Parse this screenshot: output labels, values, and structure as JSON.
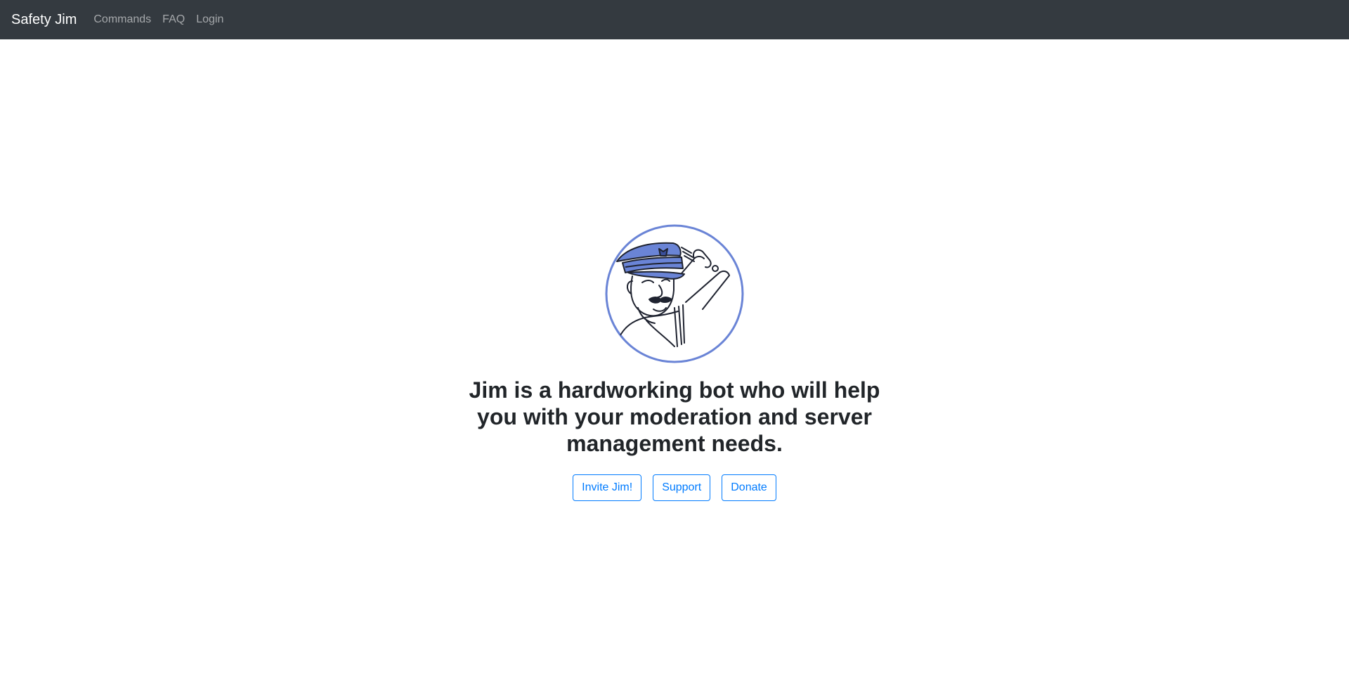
{
  "navbar": {
    "brand": "Safety Jim",
    "links": [
      {
        "label": "Commands"
      },
      {
        "label": "FAQ"
      },
      {
        "label": "Login"
      }
    ]
  },
  "hero": {
    "logo_icon": "saluting-police-officer-icon",
    "tagline": "Jim is a hardworking bot who will help you with your moderation and server management needs.",
    "buttons": [
      {
        "label": "Invite Jim!"
      },
      {
        "label": "Support"
      },
      {
        "label": "Donate"
      }
    ]
  },
  "colors": {
    "navbar_bg": "#343a40",
    "accent": "#007bff",
    "logo_accent": "#6a84d6"
  }
}
